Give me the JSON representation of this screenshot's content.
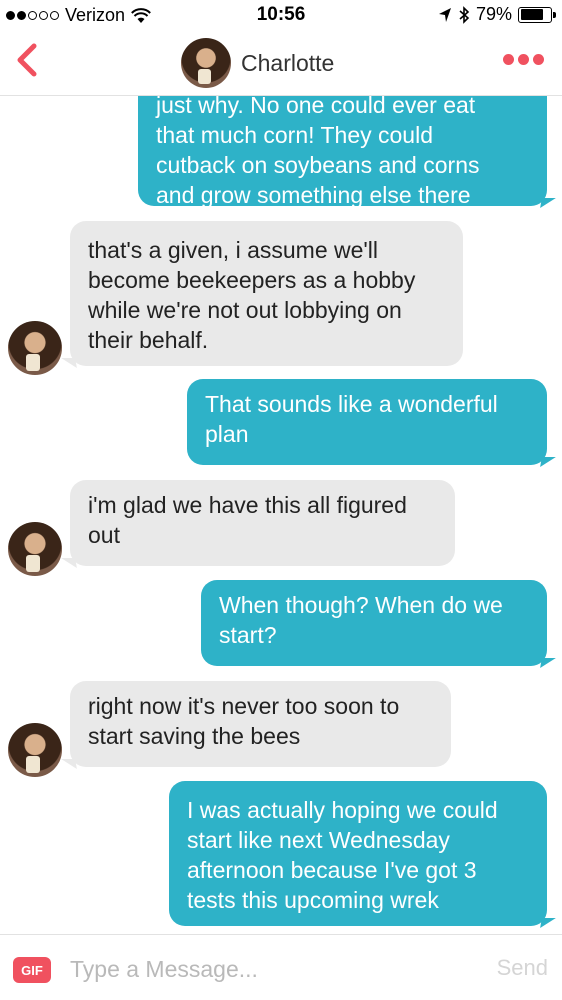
{
  "status_bar": {
    "carrier": "Verizon",
    "time": "10:56",
    "battery": "79%",
    "battery_level": 0.79,
    "icons": [
      "signal-dots",
      "wifi-icon",
      "location-arrow-icon",
      "bluetooth-icon",
      "battery-icon"
    ]
  },
  "header": {
    "title": "Charlotte",
    "back_icon": "chevron-left-icon",
    "more_icon": "more-dots-icon",
    "accent": "#f0515f"
  },
  "messages": [
    {
      "direction": "out",
      "lines": [
        "just why. No one could ever eat",
        "that much corn! They could",
        "cutback on soybeans and corns",
        "and grow something else there"
      ]
    },
    {
      "direction": "in",
      "lines": [
        "that's a given, i assume we'll",
        "become beekeepers as a hobby",
        "while we're not out lobbying on",
        "their behalf."
      ]
    },
    {
      "direction": "out",
      "lines": [
        "That sounds like a wonderful",
        "plan"
      ]
    },
    {
      "direction": "in",
      "lines": [
        "i'm glad we have this all figured",
        "out"
      ]
    },
    {
      "direction": "out",
      "lines": [
        "When though? When do we",
        "start?"
      ]
    },
    {
      "direction": "in",
      "lines": [
        "right now it's never too soon to",
        "start saving the bees"
      ]
    },
    {
      "direction": "out",
      "lines": [
        "I was actually hoping we could",
        "start like next Wednesday",
        "afternoon because I've got 3",
        "tests this upcoming wrek"
      ]
    }
  ],
  "composer": {
    "gif_label": "GIF",
    "placeholder": "Type a Message...",
    "send_label": "Send"
  },
  "colors": {
    "outgoing_bubble": "#2eb2c8",
    "incoming_bubble": "#e9e9e9",
    "accent": "#f0515f"
  }
}
